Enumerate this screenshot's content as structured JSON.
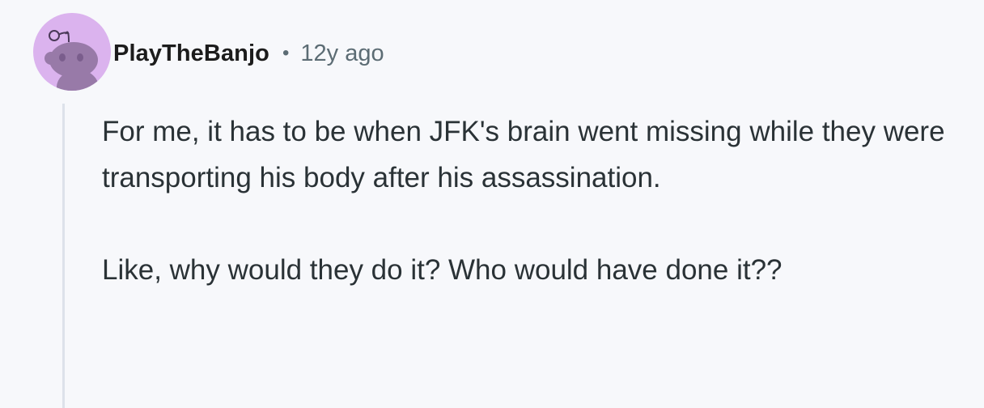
{
  "comment": {
    "author": "PlayTheBanjo",
    "separator": "•",
    "age": "12y ago",
    "avatar_icon": "snoo-avatar-icon",
    "avatar_color": "#dbb3ee",
    "paragraphs": [
      "For me, it has to be when JFK's brain went missing while they were transporting his body after his assassination.",
      "Like, why would they do it? Who would have done it??"
    ]
  }
}
